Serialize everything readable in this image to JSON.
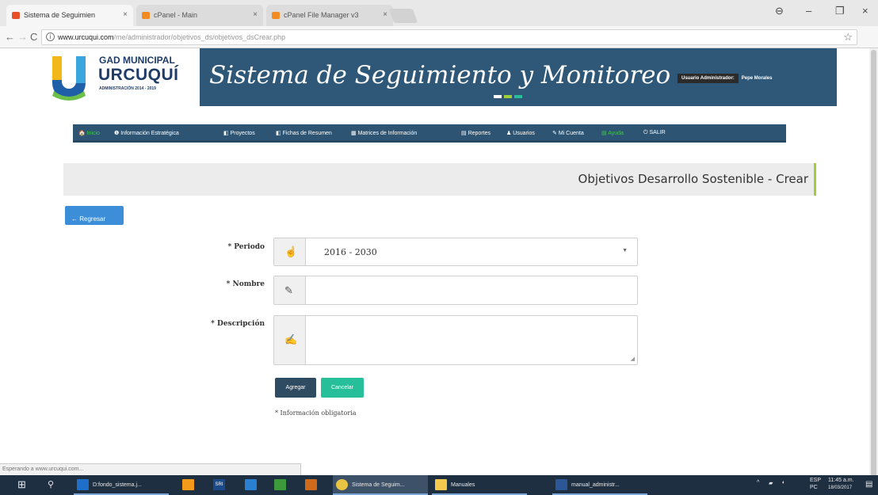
{
  "browser": {
    "tabs": [
      {
        "label": "Sistema de Seguimien",
        "close": "×"
      },
      {
        "label": "cPanel - Main",
        "close": "×"
      },
      {
        "label": "cPanel File Manager v3",
        "close": "×"
      }
    ],
    "window_controls": {
      "account": "⊖",
      "minimize": "–",
      "maximize": "❐",
      "close": "×"
    },
    "nav": {
      "back": "←",
      "forward": "→",
      "reload": "C"
    },
    "address": {
      "info": "i",
      "host": "www.urcuqui.com",
      "path": "/me/administrador/objetivos_ds/objetivos_dsCrear.php"
    },
    "bookmark_star": "☆"
  },
  "site": {
    "logo": {
      "line1": "GAD MUNICIPAL",
      "line2": "URCUQUÍ",
      "line3": "ADMINISTRACIÓN 2014 - 2019"
    },
    "title": "Sistema de Seguimiento y Monitoreo",
    "title_dash_colors": [
      "#ffffff",
      "#9fce3b",
      "#27bf9a"
    ],
    "user_label": "Usuario Administrador:",
    "user_name": "Pepe Morales",
    "nav": [
      {
        "icon": "🏠",
        "label": "Inicio"
      },
      {
        "icon": "❶",
        "label": "Información Estratégica"
      },
      {
        "icon": "◧",
        "label": "Proyectos"
      },
      {
        "icon": "◧",
        "label": "Fichas de Resumen"
      },
      {
        "icon": "▦",
        "label": "Matrices de Información"
      },
      {
        "icon": "▤",
        "label": "Reportes"
      },
      {
        "icon": "♟",
        "label": "Usuarios"
      },
      {
        "icon": "✎",
        "label": "Mi Cuenta"
      },
      {
        "icon": "▤",
        "label": "Ayuda"
      },
      {
        "icon": "⏻",
        "label": "SALIR"
      }
    ]
  },
  "page": {
    "title": "Objetivos Desarrollo Sostenible - Crear",
    "back_label": "← Regresar",
    "form": {
      "period_label": "* Periodo",
      "period_value": "2016 - 2030",
      "name_label": "* Nombre",
      "description_label": "* Descripción",
      "save_label": "Agregar",
      "cancel_label": "Cancelar",
      "required_note": "* Información obligatoria"
    }
  },
  "status_text": "Esperando a www.urcuqui.com...",
  "taskbar": {
    "items": [
      {
        "label": "D:fondo_sistema.j...",
        "color": "#1e6fc9"
      },
      {
        "label": "",
        "color": "#f39a1b"
      },
      {
        "label": "SRI",
        "color": "#1a4a8a"
      },
      {
        "label": "",
        "color": "#2a7fd0"
      },
      {
        "label": "",
        "color": "#3c9a3c"
      },
      {
        "label": "",
        "color": "#cf6a1a"
      },
      {
        "label": "Sistema de Seguim...",
        "color": "#e8c442"
      },
      {
        "label": "Manuales",
        "color": "#f2c94c"
      },
      {
        "label": "manual_administr...",
        "color": "#2b5797"
      }
    ],
    "tray": {
      "arrows": "^",
      "lang_top": "ESP",
      "lang_bottom": "PC",
      "time": "11:45 a.m.",
      "date": "18/03/2017"
    }
  }
}
